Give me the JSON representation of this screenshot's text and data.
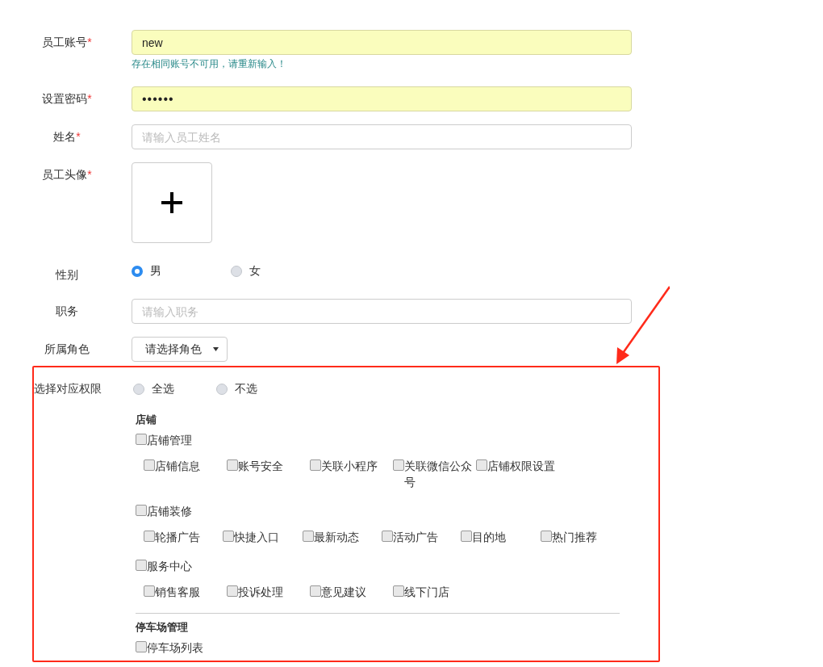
{
  "account": {
    "label": "员工账号",
    "required_mark": "*",
    "value": "new",
    "hint": "存在相同账号不可用，请重新输入！"
  },
  "password": {
    "label": "设置密码",
    "required_mark": "*",
    "value": "••••••"
  },
  "name": {
    "label": "姓名",
    "required_mark": "*",
    "placeholder": "请输入员工姓名"
  },
  "avatar": {
    "label": "员工头像",
    "required_mark": "*"
  },
  "gender": {
    "label": "性别",
    "options": [
      {
        "label": "男",
        "selected": true
      },
      {
        "label": "女",
        "selected": false
      }
    ]
  },
  "position": {
    "label": "职务",
    "placeholder": "请输入职务"
  },
  "role": {
    "label": "所属角色",
    "value": "请选择角色"
  },
  "permissions": {
    "label": "选择对应权限",
    "options": [
      {
        "label": "全选",
        "selected": false
      },
      {
        "label": "不选",
        "selected": false
      }
    ],
    "groups": [
      {
        "title": "店铺",
        "modules": [
          {
            "label": "店铺管理",
            "checked": false,
            "items": [
              {
                "label": "店铺信息",
                "checked": false
              },
              {
                "label": "账号安全",
                "checked": false
              },
              {
                "label": "关联小程序",
                "checked": false
              },
              {
                "label": "关联微信公众号",
                "checked": false
              },
              {
                "label": "店铺权限设置",
                "checked": false
              }
            ]
          },
          {
            "label": "店铺装修",
            "checked": false,
            "items": [
              {
                "label": "轮播广告",
                "checked": false
              },
              {
                "label": "快捷入口",
                "checked": false
              },
              {
                "label": "最新动态",
                "checked": false
              },
              {
                "label": "活动广告",
                "checked": false
              },
              {
                "label": "目的地",
                "checked": false
              },
              {
                "label": "热门推荐",
                "checked": false
              }
            ]
          },
          {
            "label": "服务中心",
            "checked": false,
            "items": [
              {
                "label": "销售客服",
                "checked": false
              },
              {
                "label": "投诉处理",
                "checked": false
              },
              {
                "label": "意见建议",
                "checked": false
              },
              {
                "label": "线下门店",
                "checked": false
              }
            ]
          }
        ]
      },
      {
        "title": "停车场管理",
        "modules": [
          {
            "label": "停车场列表",
            "checked": false
          }
        ]
      }
    ]
  }
}
